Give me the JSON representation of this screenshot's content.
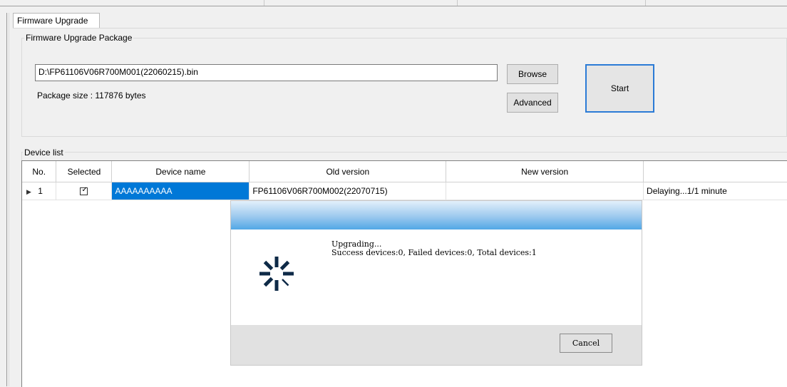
{
  "tab": {
    "label": "Firmware Upgrade"
  },
  "package": {
    "group_label": "Firmware Upgrade Package",
    "path_value": "D:\\FP61106V06R700M001(22060215).bin",
    "size_text": "Package size : 117876  bytes",
    "browse_label": "Browse",
    "advanced_label": "Advanced",
    "start_label": "Start"
  },
  "device_list": {
    "group_label": "Device list",
    "columns": [
      "No.",
      "Selected",
      "Device name",
      "Old version",
      "New version",
      ""
    ],
    "rows": [
      {
        "no": "1",
        "selected": true,
        "device_name": "AAAAAAAAAA",
        "old_version": "FP61106V06R700M002(22070715)",
        "new_version": "",
        "status": "Delaying...1/1 minute"
      }
    ]
  },
  "dialog": {
    "line1": "Upgrading...",
    "line2": "Success devices:0, Failed devices:0, Total devices:1",
    "cancel_label": "Cancel"
  },
  "colors": {
    "accent": "#0078d7",
    "start_border": "#2b7bd6",
    "dialog_title_start": "#e3f0fb",
    "dialog_title_end": "#52a7e6",
    "spinner": "#0e2a47"
  },
  "icons": {
    "spinner": "loading-spinner-icon",
    "row_indicator": "row-pointer-icon",
    "checkbox": "checkbox-checked-icon"
  }
}
